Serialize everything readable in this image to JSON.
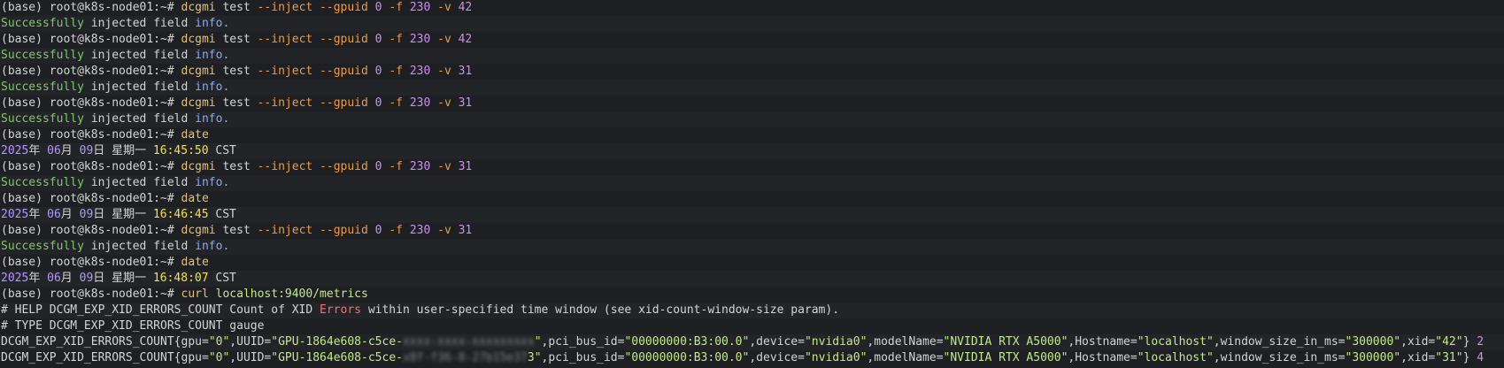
{
  "terminal": {
    "lines": [
      {
        "kind": "cmd",
        "tokens": [
          {
            "t": "(base) root@k8s-node01:~# ",
            "c": "white"
          },
          {
            "t": "dcgmi",
            "c": "yellow"
          },
          {
            "t": " test ",
            "c": "white"
          },
          {
            "t": "--inject --gpuid",
            "c": "orange"
          },
          {
            "t": " ",
            "c": "white"
          },
          {
            "t": "0",
            "c": "purple"
          },
          {
            "t": " ",
            "c": "white"
          },
          {
            "t": "-f",
            "c": "orange"
          },
          {
            "t": " ",
            "c": "white"
          },
          {
            "t": "230",
            "c": "purple"
          },
          {
            "t": " ",
            "c": "white"
          },
          {
            "t": "-v",
            "c": "orange"
          },
          {
            "t": " ",
            "c": "white"
          },
          {
            "t": "42",
            "c": "purple"
          }
        ]
      },
      {
        "kind": "out",
        "tokens": [
          {
            "t": "Successfully",
            "c": "green"
          },
          {
            "t": " injected field ",
            "c": "white"
          },
          {
            "t": "info.",
            "c": "blue"
          }
        ]
      },
      {
        "kind": "cmd",
        "tokens": [
          {
            "t": "(base) root@k8s-node01:~# ",
            "c": "white"
          },
          {
            "t": "dcgmi",
            "c": "yellow"
          },
          {
            "t": " test ",
            "c": "white"
          },
          {
            "t": "--inject --gpuid",
            "c": "orange"
          },
          {
            "t": " ",
            "c": "white"
          },
          {
            "t": "0",
            "c": "purple"
          },
          {
            "t": " ",
            "c": "white"
          },
          {
            "t": "-f",
            "c": "orange"
          },
          {
            "t": " ",
            "c": "white"
          },
          {
            "t": "230",
            "c": "purple"
          },
          {
            "t": " ",
            "c": "white"
          },
          {
            "t": "-v",
            "c": "orange"
          },
          {
            "t": " ",
            "c": "white"
          },
          {
            "t": "42",
            "c": "purple"
          }
        ]
      },
      {
        "kind": "out",
        "tokens": [
          {
            "t": "Successfully",
            "c": "green"
          },
          {
            "t": " injected field ",
            "c": "white"
          },
          {
            "t": "info.",
            "c": "blue"
          }
        ]
      },
      {
        "kind": "cmd",
        "tokens": [
          {
            "t": "(base) root@k8s-node01:~# ",
            "c": "white"
          },
          {
            "t": "dcgmi",
            "c": "yellow"
          },
          {
            "t": " test ",
            "c": "white"
          },
          {
            "t": "--inject --gpuid",
            "c": "orange"
          },
          {
            "t": " ",
            "c": "white"
          },
          {
            "t": "0",
            "c": "purple"
          },
          {
            "t": " ",
            "c": "white"
          },
          {
            "t": "-f",
            "c": "orange"
          },
          {
            "t": " ",
            "c": "white"
          },
          {
            "t": "230",
            "c": "purple"
          },
          {
            "t": " ",
            "c": "white"
          },
          {
            "t": "-v",
            "c": "orange"
          },
          {
            "t": " ",
            "c": "white"
          },
          {
            "t": "31",
            "c": "purple"
          }
        ]
      },
      {
        "kind": "out",
        "tokens": [
          {
            "t": "Successfully",
            "c": "green"
          },
          {
            "t": " injected field ",
            "c": "white"
          },
          {
            "t": "info.",
            "c": "blue"
          }
        ]
      },
      {
        "kind": "cmd",
        "tokens": [
          {
            "t": "(base) root@k8s-node01:~# ",
            "c": "white"
          },
          {
            "t": "dcgmi",
            "c": "yellow"
          },
          {
            "t": " test ",
            "c": "white"
          },
          {
            "t": "--inject --gpuid",
            "c": "orange"
          },
          {
            "t": " ",
            "c": "white"
          },
          {
            "t": "0",
            "c": "purple"
          },
          {
            "t": " ",
            "c": "white"
          },
          {
            "t": "-f",
            "c": "orange"
          },
          {
            "t": " ",
            "c": "white"
          },
          {
            "t": "230",
            "c": "purple"
          },
          {
            "t": " ",
            "c": "white"
          },
          {
            "t": "-v",
            "c": "orange"
          },
          {
            "t": " ",
            "c": "white"
          },
          {
            "t": "31",
            "c": "purple"
          }
        ]
      },
      {
        "kind": "out",
        "tokens": [
          {
            "t": "Successfully",
            "c": "green"
          },
          {
            "t": " injected field ",
            "c": "white"
          },
          {
            "t": "info.",
            "c": "blue"
          }
        ]
      },
      {
        "kind": "cmd",
        "tokens": [
          {
            "t": "(base) root@k8s-node01:~# ",
            "c": "white"
          },
          {
            "t": "date",
            "c": "yellow"
          }
        ]
      },
      {
        "kind": "out",
        "tokens": [
          {
            "t": "2025",
            "c": "violet"
          },
          {
            "t": "年 ",
            "c": "white"
          },
          {
            "t": "06",
            "c": "violet"
          },
          {
            "t": "月 ",
            "c": "white"
          },
          {
            "t": "09",
            "c": "violet"
          },
          {
            "t": "日 星期一 ",
            "c": "white"
          },
          {
            "t": "16:45:50",
            "c": "bright-yellow"
          },
          {
            "t": " CST",
            "c": "white"
          }
        ]
      },
      {
        "kind": "cmd",
        "tokens": [
          {
            "t": "(base) root@k8s-node01:~# ",
            "c": "white"
          },
          {
            "t": "dcgmi",
            "c": "yellow"
          },
          {
            "t": " test ",
            "c": "white"
          },
          {
            "t": "--inject --gpuid",
            "c": "orange"
          },
          {
            "t": " ",
            "c": "white"
          },
          {
            "t": "0",
            "c": "purple"
          },
          {
            "t": " ",
            "c": "white"
          },
          {
            "t": "-f",
            "c": "orange"
          },
          {
            "t": " ",
            "c": "white"
          },
          {
            "t": "230",
            "c": "purple"
          },
          {
            "t": " ",
            "c": "white"
          },
          {
            "t": "-v",
            "c": "orange"
          },
          {
            "t": " ",
            "c": "white"
          },
          {
            "t": "31",
            "c": "purple"
          }
        ]
      },
      {
        "kind": "out",
        "tokens": [
          {
            "t": "Successfully",
            "c": "green"
          },
          {
            "t": " injected field ",
            "c": "white"
          },
          {
            "t": "info.",
            "c": "blue"
          }
        ]
      },
      {
        "kind": "cmd",
        "tokens": [
          {
            "t": "(base) root@k8s-node01:~# ",
            "c": "white"
          },
          {
            "t": "date",
            "c": "yellow"
          }
        ]
      },
      {
        "kind": "out",
        "tokens": [
          {
            "t": "2025",
            "c": "violet"
          },
          {
            "t": "年 ",
            "c": "white"
          },
          {
            "t": "06",
            "c": "violet"
          },
          {
            "t": "月 ",
            "c": "white"
          },
          {
            "t": "09",
            "c": "violet"
          },
          {
            "t": "日 星期一 ",
            "c": "white"
          },
          {
            "t": "16:46:45",
            "c": "bright-yellow"
          },
          {
            "t": " CST",
            "c": "white"
          }
        ]
      },
      {
        "kind": "cmd",
        "tokens": [
          {
            "t": "(base) root@k8s-node01:~# ",
            "c": "white"
          },
          {
            "t": "dcgmi",
            "c": "yellow"
          },
          {
            "t": " test ",
            "c": "white"
          },
          {
            "t": "--inject --gpuid",
            "c": "orange"
          },
          {
            "t": " ",
            "c": "white"
          },
          {
            "t": "0",
            "c": "purple"
          },
          {
            "t": " ",
            "c": "white"
          },
          {
            "t": "-f",
            "c": "orange"
          },
          {
            "t": " ",
            "c": "white"
          },
          {
            "t": "230",
            "c": "purple"
          },
          {
            "t": " ",
            "c": "white"
          },
          {
            "t": "-v",
            "c": "orange"
          },
          {
            "t": " ",
            "c": "white"
          },
          {
            "t": "31",
            "c": "purple"
          }
        ]
      },
      {
        "kind": "out",
        "tokens": [
          {
            "t": "Successfully",
            "c": "green"
          },
          {
            "t": " injected field ",
            "c": "white"
          },
          {
            "t": "info.",
            "c": "blue"
          }
        ]
      },
      {
        "kind": "cmd",
        "tokens": [
          {
            "t": "(base) root@k8s-node01:~# ",
            "c": "white"
          },
          {
            "t": "date",
            "c": "yellow"
          }
        ]
      },
      {
        "kind": "out",
        "tokens": [
          {
            "t": "2025",
            "c": "violet"
          },
          {
            "t": "年 ",
            "c": "white"
          },
          {
            "t": "06",
            "c": "violet"
          },
          {
            "t": "月 ",
            "c": "white"
          },
          {
            "t": "09",
            "c": "violet"
          },
          {
            "t": "日 星期一 ",
            "c": "white"
          },
          {
            "t": "16:48:07",
            "c": "bright-yellow"
          },
          {
            "t": " CST",
            "c": "white"
          }
        ]
      },
      {
        "kind": "cmd",
        "tokens": [
          {
            "t": "(base) root@k8s-node01:~# ",
            "c": "white"
          },
          {
            "t": "curl",
            "c": "yellow"
          },
          {
            "t": " ",
            "c": "white"
          },
          {
            "t": "localhost:9400/metrics",
            "c": "lime"
          }
        ]
      },
      {
        "kind": "out",
        "tokens": [
          {
            "t": "# HELP DCGM_EXP_XID_ERRORS_COUNT Count of XID ",
            "c": "white"
          },
          {
            "t": "Errors",
            "c": "red"
          },
          {
            "t": " within user-specified time window (see xid-count-window-size param).",
            "c": "white"
          }
        ]
      },
      {
        "kind": "out",
        "tokens": [
          {
            "t": "# TYPE DCGM_EXP_XID_ERRORS_COUNT ",
            "c": "white"
          },
          {
            "t": "gauge",
            "c": "white"
          }
        ]
      },
      {
        "kind": "out",
        "tokens": [
          {
            "t": "DCGM_EXP_XID_ERRORS_COUNT{gpu=",
            "c": "white"
          },
          {
            "t": "\"0\"",
            "c": "lime"
          },
          {
            "t": ",UUID=",
            "c": "white"
          },
          {
            "t": "\"GPU-1864e608-c5ce-",
            "c": "lime"
          },
          {
            "t": "xxxx-xxxx-xxxxxxxxx",
            "c": "redact"
          },
          {
            "t": "\"",
            "c": "lime"
          },
          {
            "t": ",pci_bus_id=",
            "c": "white"
          },
          {
            "t": "\"00000000:B3:00.0\"",
            "c": "lime"
          },
          {
            "t": ",device=",
            "c": "white"
          },
          {
            "t": "\"nvidia0\"",
            "c": "lime"
          },
          {
            "t": ",modelName=",
            "c": "white"
          },
          {
            "t": "\"NVIDIA RTX A5000\"",
            "c": "lime"
          },
          {
            "t": ",Hostname=",
            "c": "white"
          },
          {
            "t": "\"localhost\"",
            "c": "lime"
          },
          {
            "t": ",window_size_in_ms=",
            "c": "white"
          },
          {
            "t": "\"300000\"",
            "c": "lime"
          },
          {
            "t": ",xid=",
            "c": "white"
          },
          {
            "t": "\"42\"",
            "c": "lime"
          },
          {
            "t": "} ",
            "c": "white"
          },
          {
            "t": "2",
            "c": "purple"
          }
        ]
      },
      {
        "kind": "out",
        "tokens": [
          {
            "t": "DCGM_EXP_XID_ERRORS_COUNT{gpu=",
            "c": "white"
          },
          {
            "t": "\"0\"",
            "c": "lime"
          },
          {
            "t": ",UUID=",
            "c": "white"
          },
          {
            "t": "\"GPU-1864e608-c5ce-",
            "c": "lime"
          },
          {
            "t": "x8f-f36-8-27b15e37",
            "c": "redact"
          },
          {
            "t": "3\"",
            "c": "lime"
          },
          {
            "t": ",pci_bus_id=",
            "c": "white"
          },
          {
            "t": "\"00000000:B3:00.0\"",
            "c": "lime"
          },
          {
            "t": ",device=",
            "c": "white"
          },
          {
            "t": "\"nvidia0\"",
            "c": "lime"
          },
          {
            "t": ",modelName=",
            "c": "white"
          },
          {
            "t": "\"NVIDIA RTX A5000\"",
            "c": "lime"
          },
          {
            "t": ",Hostname=",
            "c": "white"
          },
          {
            "t": "\"localhost\"",
            "c": "lime"
          },
          {
            "t": ",window_size_in_ms=",
            "c": "white"
          },
          {
            "t": "\"300000\"",
            "c": "lime"
          },
          {
            "t": ",xid=",
            "c": "white"
          },
          {
            "t": "\"31\"",
            "c": "lime"
          },
          {
            "t": "} ",
            "c": "white"
          },
          {
            "t": "4",
            "c": "purple"
          }
        ]
      }
    ]
  }
}
